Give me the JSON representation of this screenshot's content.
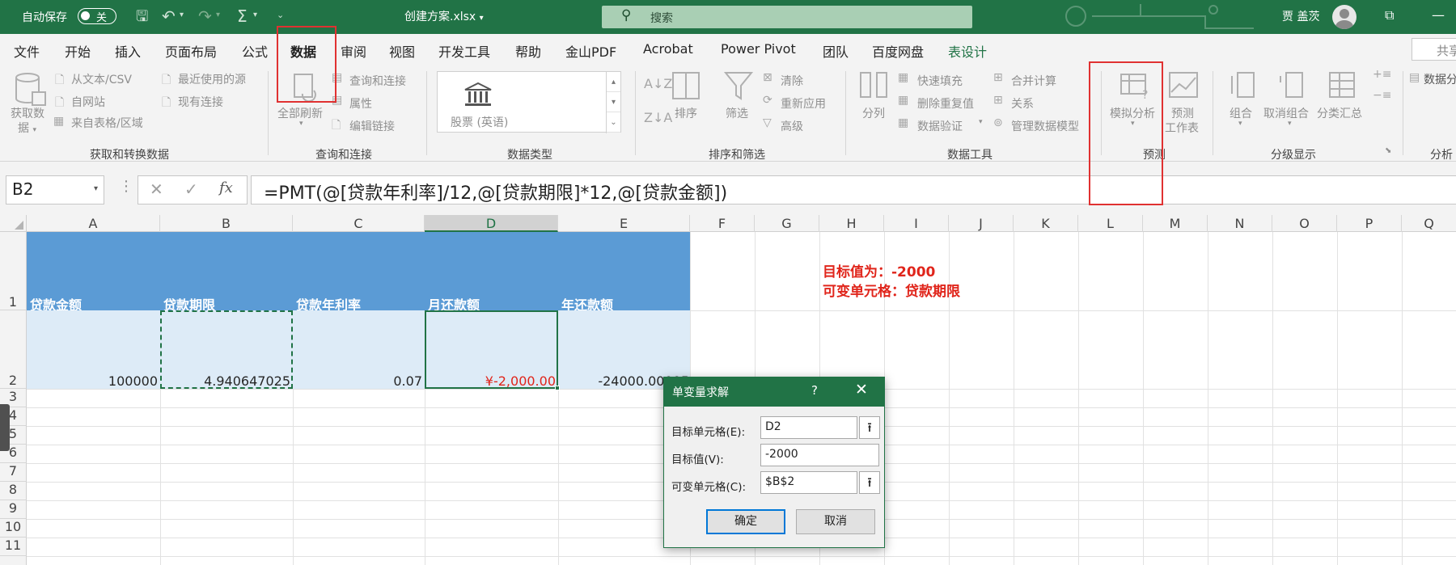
{
  "titlebar": {
    "autosave_label": "自动保存",
    "autosave_state": "关",
    "filename": "创建方案.xlsx",
    "search_placeholder": "搜索",
    "user_name": "贾 盖茨",
    "accent": "#217346"
  },
  "tabs": [
    {
      "label": "文件"
    },
    {
      "label": "开始"
    },
    {
      "label": "插入"
    },
    {
      "label": "页面布局"
    },
    {
      "label": "公式"
    },
    {
      "label": "数据"
    },
    {
      "label": "审阅"
    },
    {
      "label": "视图"
    },
    {
      "label": "开发工具"
    },
    {
      "label": "帮助"
    },
    {
      "label": "金山PDF"
    },
    {
      "label": "Acrobat"
    },
    {
      "label": "Power Pivot"
    },
    {
      "label": "团队"
    },
    {
      "label": "百度网盘"
    },
    {
      "label": "表设计"
    }
  ],
  "share_label": "共享",
  "ribbon": {
    "get_data": {
      "line1": "获取数",
      "line2": "据"
    },
    "from_text_csv": "从文本/CSV",
    "from_web": "自网站",
    "from_table": "来自表格/区域",
    "recent_sources": "最近使用的源",
    "existing_conn": "现有连接",
    "group_get_transform": "获取和转换数据",
    "refresh_all": "全部刷新",
    "queries_conn": "查询和连接",
    "properties": "属性",
    "edit_links": "编辑链接",
    "group_queries": "查询和连接",
    "stock_label": "股票 (英语)",
    "group_datatype": "数据类型",
    "sort": "排序",
    "filter": "筛选",
    "clear": "清除",
    "reapply": "重新应用",
    "advanced": "高级",
    "group_sortfilter": "排序和筛选",
    "text_to_cols": "分列",
    "flash_fill": "快速填充",
    "remove_dup": "删除重复值",
    "data_validation": "数据验证",
    "consolidate": "合并计算",
    "relationships": "关系",
    "manage_model": "管理数据模型",
    "group_datatools": "数据工具",
    "whatif": "模拟分析",
    "forecast_line1": "预测",
    "forecast_line2": "工作表",
    "group_forecast": "预测",
    "group_btn": "组合",
    "ungroup": "取消组合",
    "subtotal": "分类汇总",
    "group_outline": "分级显示",
    "data_analysis": "数据分",
    "group_analysis": "分析"
  },
  "formula_bar": {
    "name_box": "B2",
    "fx": "fx",
    "formula": "=PMT(@[贷款年利率]/12,@[贷款期限]*12,@[贷款金额])"
  },
  "columns": [
    "A",
    "B",
    "C",
    "D",
    "E",
    "F",
    "G",
    "H",
    "I",
    "J",
    "K",
    "L",
    "M",
    "N",
    "O",
    "P",
    "Q"
  ],
  "rows": [
    "1",
    "2",
    "3",
    "4",
    "5",
    "6",
    "7",
    "8",
    "9",
    "10",
    "11"
  ],
  "table": {
    "headers": [
      "贷款金额",
      "贷款期限",
      "贷款年利率",
      "月还款额",
      "年还款额"
    ],
    "values": [
      "100000",
      "4.940647025",
      "0.07",
      "¥-2,000.00",
      "-24000.00005"
    ],
    "header_color": "#5b9bd5",
    "band_color": "#ddebf7",
    "negative_color": "#e0251b"
  },
  "notes": {
    "line1": "目标值为：-2000",
    "line2": "可变单元格：贷款期限"
  },
  "dialog": {
    "title": "单变量求解",
    "help": "?",
    "close": "✕",
    "set_cell_label": "目标单元格(E):",
    "set_cell_value": "D2",
    "to_value_label": "目标值(V):",
    "to_value_value": "-2000",
    "changing_cell_label": "可变单元格(C):",
    "changing_cell_value": "$B$2",
    "ok": "确定",
    "cancel": "取消"
  }
}
